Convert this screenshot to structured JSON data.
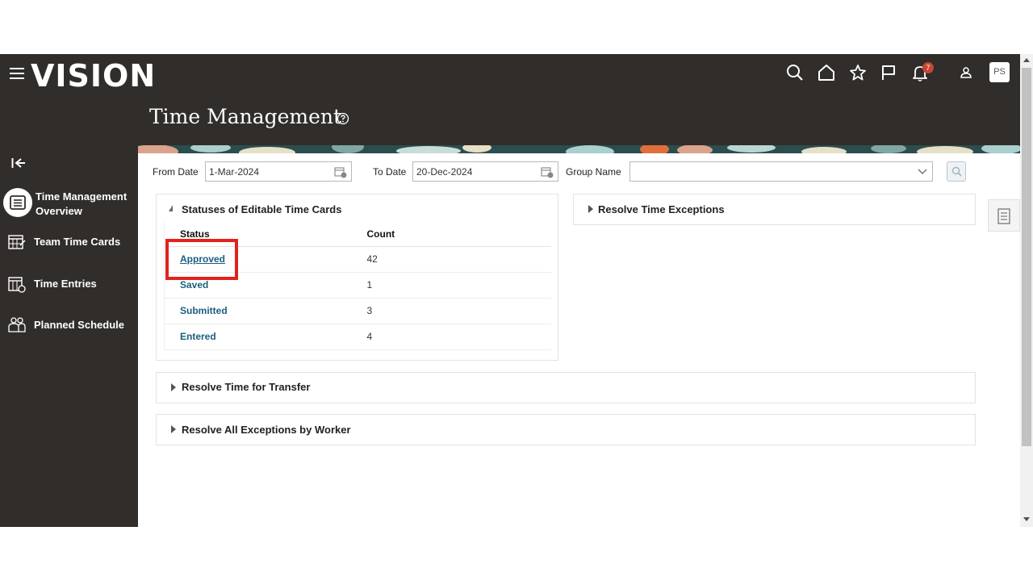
{
  "header": {
    "logo": "VISION",
    "notification_count": "7",
    "avatar_initials": "PS",
    "page_title": "Time Management"
  },
  "sidebar": {
    "items": [
      {
        "label_line1": "Time Management",
        "label_line2": "Overview",
        "icon": "list-icon",
        "active": true
      },
      {
        "label": "Team Time Cards",
        "icon": "calendar-grid-icon"
      },
      {
        "label": "Time Entries",
        "icon": "calendar-clock-icon"
      },
      {
        "label": "Planned Schedule",
        "icon": "people-schedule-icon"
      }
    ]
  },
  "filters": {
    "from_date_label": "From Date",
    "from_date_value": "1-Mar-2024",
    "to_date_label": "To Date",
    "to_date_value": "20-Dec-2024",
    "group_name_label": "Group Name",
    "group_name_value": ""
  },
  "statuses_panel": {
    "title": "Statuses of Editable Time Cards",
    "col_status": "Status",
    "col_count": "Count",
    "rows": [
      {
        "status": "Approved",
        "count": "42"
      },
      {
        "status": "Saved",
        "count": "1"
      },
      {
        "status": "Submitted",
        "count": "3"
      },
      {
        "status": "Entered",
        "count": "4"
      }
    ]
  },
  "exceptions_panel": {
    "title": "Resolve Time Exceptions"
  },
  "transfer_panel": {
    "title": "Resolve Time for Transfer"
  },
  "worker_panel": {
    "title": "Resolve All Exceptions by Worker"
  },
  "colors": {
    "header_bg": "#312d2a",
    "link": "#1b5e7d",
    "highlight": "#e0231d",
    "badge": "#c74634"
  }
}
